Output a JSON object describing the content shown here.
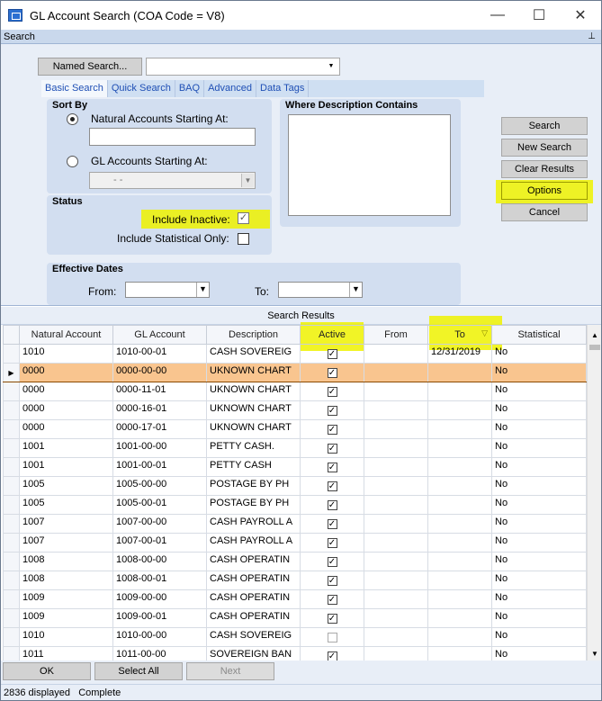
{
  "window": {
    "title": "GL Account Search (COA Code = V8)",
    "minimize": "—",
    "maximize": "☐",
    "close": "✕"
  },
  "search_strip": {
    "label": "Search",
    "pin": "📌"
  },
  "named_search": {
    "button": "Named Search...",
    "value": ""
  },
  "tabs": [
    "Basic Search",
    "Quick Search",
    "BAQ",
    "Advanced",
    "Data Tags"
  ],
  "sort_by": {
    "title": "Sort By",
    "natural_label": "Natural Accounts Starting At:",
    "natural_value": "",
    "gl_label": "GL Accounts Starting At:",
    "gl_value": "-   -"
  },
  "where_desc": {
    "title": "Where Description Contains",
    "value": ""
  },
  "status": {
    "title": "Status",
    "include_inactive": "Include Inactive:",
    "include_inactive_checked": true,
    "include_statistical": "Include Statistical Only:",
    "include_statistical_checked": false
  },
  "effective_dates": {
    "title": "Effective Dates",
    "from_label": "From:",
    "to_label": "To:"
  },
  "side_buttons": {
    "search": "Search",
    "new_search": "New Search",
    "clear_results": "Clear Results",
    "options": "Options",
    "cancel": "Cancel"
  },
  "results": {
    "title": "Search Results",
    "columns": [
      "Natural Account",
      "GL Account",
      "Description",
      "Active",
      "From",
      "To",
      "Statistical"
    ],
    "rows": [
      {
        "natural": "1010",
        "gl": "1010-00-01",
        "desc": "CASH SOVEREIG",
        "active": true,
        "from": "",
        "to": "12/31/2019",
        "stat": "No"
      },
      {
        "natural": "0000",
        "gl": "0000-00-00",
        "desc": "UKNOWN CHART",
        "active": true,
        "from": "",
        "to": "",
        "stat": "No"
      },
      {
        "natural": "0000",
        "gl": "0000-11-01",
        "desc": "UKNOWN CHART",
        "active": true,
        "from": "",
        "to": "",
        "stat": "No"
      },
      {
        "natural": "0000",
        "gl": "0000-16-01",
        "desc": "UKNOWN CHART",
        "active": true,
        "from": "",
        "to": "",
        "stat": "No"
      },
      {
        "natural": "0000",
        "gl": "0000-17-01",
        "desc": "UKNOWN CHART",
        "active": true,
        "from": "",
        "to": "",
        "stat": "No"
      },
      {
        "natural": "1001",
        "gl": "1001-00-00",
        "desc": "PETTY CASH.",
        "active": true,
        "from": "",
        "to": "",
        "stat": "No"
      },
      {
        "natural": "1001",
        "gl": "1001-00-01",
        "desc": "PETTY CASH",
        "active": true,
        "from": "",
        "to": "",
        "stat": "No"
      },
      {
        "natural": "1005",
        "gl": "1005-00-00",
        "desc": "POSTAGE BY PH",
        "active": true,
        "from": "",
        "to": "",
        "stat": "No"
      },
      {
        "natural": "1005",
        "gl": "1005-00-01",
        "desc": "POSTAGE BY PH",
        "active": true,
        "from": "",
        "to": "",
        "stat": "No"
      },
      {
        "natural": "1007",
        "gl": "1007-00-00",
        "desc": "CASH PAYROLL A",
        "active": true,
        "from": "",
        "to": "",
        "stat": "No"
      },
      {
        "natural": "1007",
        "gl": "1007-00-01",
        "desc": "CASH PAYROLL A",
        "active": true,
        "from": "",
        "to": "",
        "stat": "No"
      },
      {
        "natural": "1008",
        "gl": "1008-00-00",
        "desc": "CASH OPERATIN",
        "active": true,
        "from": "",
        "to": "",
        "stat": "No"
      },
      {
        "natural": "1008",
        "gl": "1008-00-01",
        "desc": "CASH OPERATIN",
        "active": true,
        "from": "",
        "to": "",
        "stat": "No"
      },
      {
        "natural": "1009",
        "gl": "1009-00-00",
        "desc": "CASH OPERATIN",
        "active": true,
        "from": "",
        "to": "",
        "stat": "No"
      },
      {
        "natural": "1009",
        "gl": "1009-00-01",
        "desc": "CASH OPERATIN",
        "active": true,
        "from": "",
        "to": "",
        "stat": "No"
      },
      {
        "natural": "1010",
        "gl": "1010-00-00",
        "desc": "CASH SOVEREIG",
        "active": false,
        "from": "",
        "to": "",
        "stat": "No"
      },
      {
        "natural": "1011",
        "gl": "1011-00-00",
        "desc": "SOVEREIGN BAN",
        "active": true,
        "from": "",
        "to": "",
        "stat": "No"
      }
    ],
    "selected_index": 1
  },
  "bottom_buttons": {
    "ok": "OK",
    "select_all": "Select All",
    "next": "Next"
  },
  "status_bar": {
    "count": "2836 displayed",
    "state": "Complete"
  },
  "colors": {
    "highlight": "#eef200",
    "selected_row": "#f9c58f",
    "panel": "#d2def0",
    "tab_text": "#1f4fb5"
  }
}
